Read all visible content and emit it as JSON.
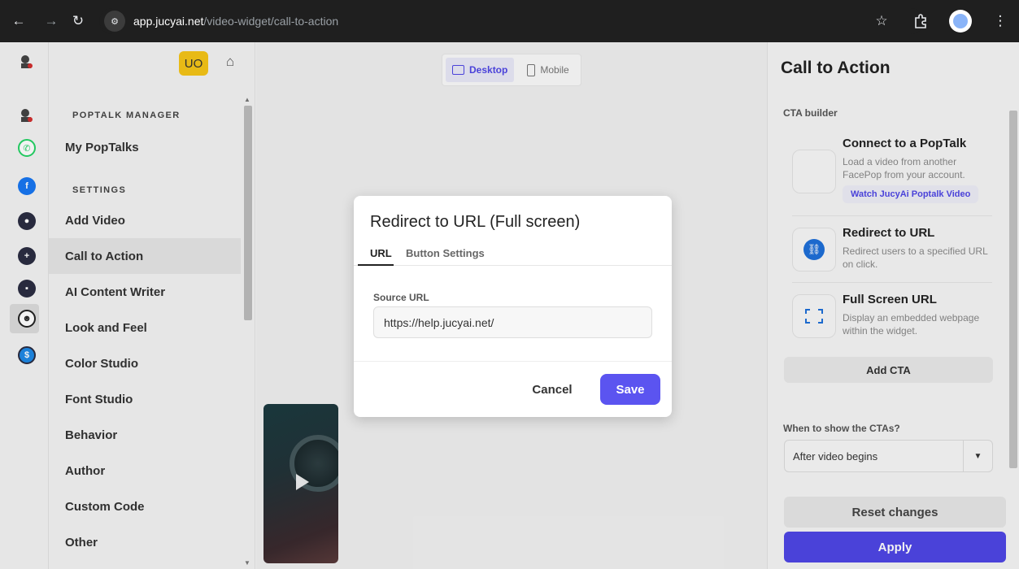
{
  "browser": {
    "url_host": "app.jucyai.net",
    "url_path": "/video-widget/call-to-action",
    "icons": [
      "back-icon",
      "forward-icon",
      "reload-icon",
      "site-info-icon",
      "star-icon",
      "extensions-icon",
      "profile-icon",
      "more-icon"
    ]
  },
  "sidebar": {
    "avatar_initials": "UO",
    "section_poptalk": "POPTALK MANAGER",
    "section_settings": "SETTINGS",
    "items": [
      {
        "label": "My PopTalks"
      },
      {
        "label": "Add Video"
      },
      {
        "label": "Call to Action"
      },
      {
        "label": "AI Content Writer"
      },
      {
        "label": "Look and Feel"
      },
      {
        "label": "Color Studio"
      },
      {
        "label": "Font Studio"
      },
      {
        "label": "Behavior"
      },
      {
        "label": "Author"
      },
      {
        "label": "Custom Code"
      },
      {
        "label": "Other"
      }
    ],
    "active_item": "Call to Action"
  },
  "rail": {
    "icons": [
      "app-logo-icon",
      "whatsapp-icon",
      "facebook-icon",
      "app-icon-1",
      "app-icon-2",
      "app-icon-3",
      "mascot-icon",
      "dollar-icon"
    ],
    "colors": {
      "whatsapp": "#25d366",
      "facebook": "#1877f2",
      "dark": "#2b2d42",
      "dollar": "#1e88e5"
    }
  },
  "canvas": {
    "device_desktop": "Desktop",
    "device_mobile": "Mobile"
  },
  "modal": {
    "title": "Redirect to URL (Full screen)",
    "tab_url": "URL",
    "tab_button_settings": "Button Settings",
    "source_url_label": "Source URL",
    "source_url_value": "https://help.jucyai.net/",
    "cancel_label": "Cancel",
    "save_label": "Save"
  },
  "right_panel": {
    "title": "Call to Action",
    "cta_builder_label": "CTA builder",
    "ctas": [
      {
        "title": "Connect to a PopTalk",
        "desc": "Load a video from another FacePop from your account.",
        "badge": "Watch JucyAi Poptalk Video"
      },
      {
        "title": "Redirect to URL",
        "desc": "Redirect users to a specified URL on click."
      },
      {
        "title": "Full Screen URL",
        "desc": "Display an embedded webpage within the widget."
      }
    ],
    "add_cta_label": "Add CTA",
    "when_label": "When to show the CTAs?",
    "when_value": "After video begins",
    "reset_label": "Reset changes",
    "apply_label": "Apply"
  },
  "colors": {
    "accent": "#4f46e5",
    "avatar_bg": "#f5c518"
  }
}
